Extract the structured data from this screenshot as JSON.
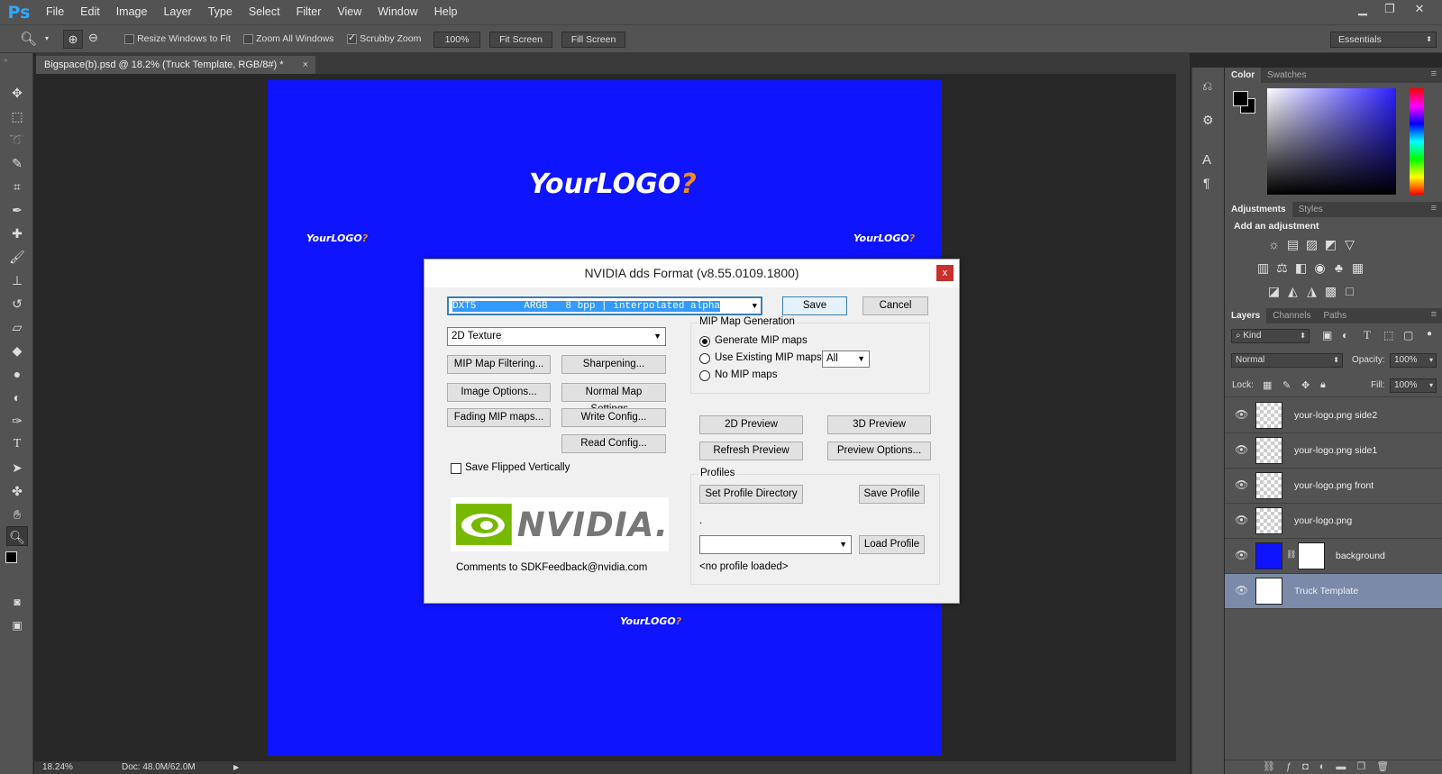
{
  "app": {
    "logo": "Ps"
  },
  "menu": [
    "File",
    "Edit",
    "Image",
    "Layer",
    "Type",
    "Select",
    "Filter",
    "View",
    "Window",
    "Help"
  ],
  "window_controls": {
    "minimize": "▁",
    "restore": "❐",
    "close": "✕"
  },
  "options": {
    "resize_windows": "Resize Windows to Fit",
    "zoom_all": "Zoom All Windows",
    "scrubby_zoom": "Scrubby Zoom",
    "zoom_pct": "100%",
    "fit_screen": "Fit Screen",
    "fill_screen": "Fill Screen",
    "workspace": "Essentials"
  },
  "document": {
    "tab_title": "Bigspace(b).psd @ 18.2% (Truck Template, RGB/8#) *",
    "logo_your": "Your",
    "logo_main": "LOGO",
    "logo_q": "?"
  },
  "status": {
    "zoom": "18.24%",
    "doc": "Doc: 48.0M/62.0M"
  },
  "panels": {
    "color_tabs": [
      "Color",
      "Swatches"
    ],
    "adjust_tabs": [
      "Adjustments",
      "Styles"
    ],
    "adjust_heading": "Add an adjustment",
    "layers_tabs": [
      "Layers",
      "Channels",
      "Paths"
    ],
    "kind": "Kind",
    "blend_mode": "Normal",
    "opacity_label": "Opacity:",
    "opacity": "100%",
    "lock_label": "Lock:",
    "fill_label": "Fill:",
    "fill": "100%",
    "layers": [
      {
        "name": "your-logo.png side2"
      },
      {
        "name": "your-logo.png side1"
      },
      {
        "name": "your-logo.png front"
      },
      {
        "name": "your-logo.png"
      },
      {
        "name": "background"
      },
      {
        "name": "Truck Template"
      }
    ]
  },
  "dialog": {
    "title": "NVIDIA dds Format (v8.55.0109.1800)",
    "close": "x",
    "format": "DXT5        ARGB   8 bpp | interpolated alpha",
    "save": "Save",
    "cancel": "Cancel",
    "texture_type": "2D Texture",
    "mip_filtering": "MIP Map Filtering...",
    "sharpening": "Sharpening...",
    "image_options": "Image Options...",
    "normal_map": "Normal Map Settings...",
    "fading_mip": "Fading MIP maps...",
    "write_config": "Write Config...",
    "read_config": "Read Config...",
    "save_flipped": "Save Flipped Vertically",
    "mip_group": "MIP Map Generation",
    "gen_mip": "Generate MIP maps",
    "use_existing": "Use Existing MIP maps",
    "no_mip": "No MIP maps",
    "mip_count": "All",
    "preview_2d": "2D Preview",
    "preview_3d": "3D Preview",
    "refresh": "Refresh Preview",
    "preview_options": "Preview Options...",
    "profiles": "Profiles",
    "set_profile_dir": "Set Profile Directory",
    "save_profile": "Save Profile",
    "dot": ".",
    "load_profile": "Load Profile",
    "no_profile": "<no profile loaded>",
    "nvidia_logo": "NVIDIA.",
    "comments": "Comments to SDKFeedback@nvidia.com"
  }
}
